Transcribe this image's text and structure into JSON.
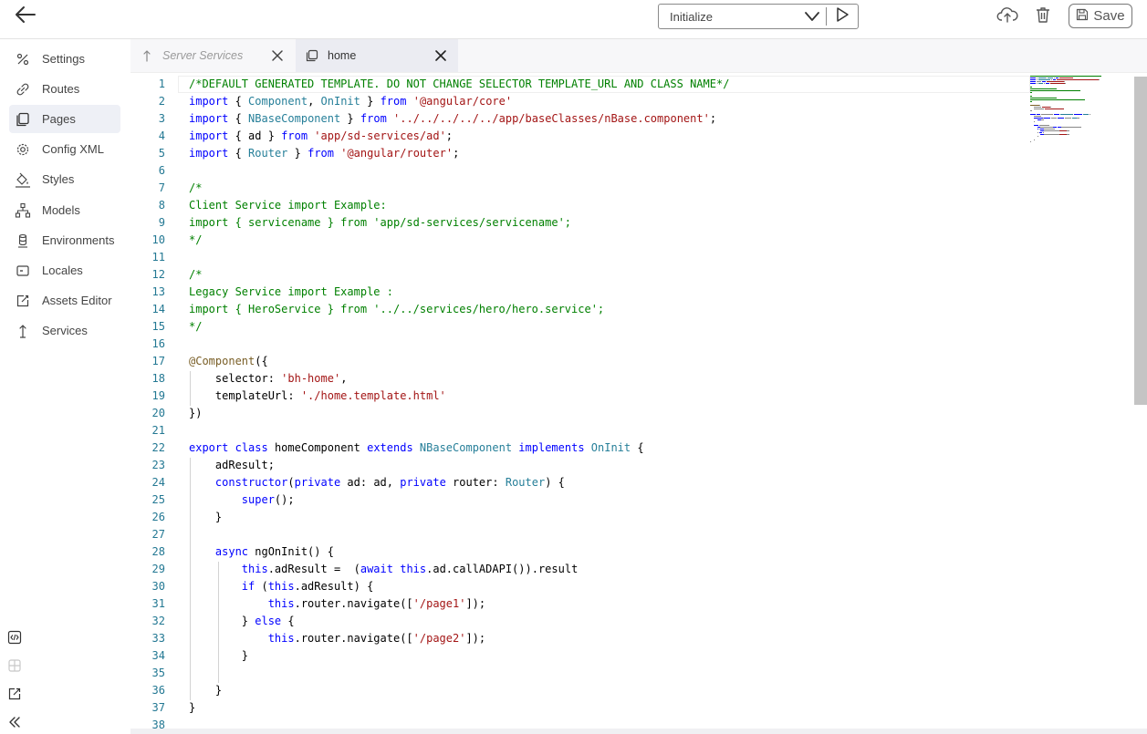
{
  "topbar": {
    "action_select": "Initialize",
    "save_label": "Save",
    "icons": [
      "back-arrow-icon",
      "chevron-down-icon",
      "play-icon",
      "cloud-upload-icon",
      "trash-icon",
      "save-disk-icon"
    ]
  },
  "sidebar": {
    "items": [
      {
        "label": "Settings",
        "icon": "settings-icon"
      },
      {
        "label": "Routes",
        "icon": "routes-icon"
      },
      {
        "label": "Pages",
        "icon": "pages-icon",
        "active": true
      },
      {
        "label": "Config XML",
        "icon": "config-gear-icon"
      },
      {
        "label": "Styles",
        "icon": "paint-bucket-icon"
      },
      {
        "label": "Models",
        "icon": "models-hierarchy-icon"
      },
      {
        "label": "Environments",
        "icon": "database-icon"
      },
      {
        "label": "Locales",
        "icon": "locales-icon"
      },
      {
        "label": "Assets Editor",
        "icon": "assets-editor-icon"
      },
      {
        "label": "Services",
        "icon": "services-icon"
      }
    ],
    "tools": [
      "code-icon",
      "grid-icon",
      "external-link-icon",
      "collapse-double-chevron-icon"
    ]
  },
  "tabs": [
    {
      "label": "Server Services",
      "icon": "services-icon",
      "active": false
    },
    {
      "label": "home",
      "icon": "file-copy-icon",
      "active": true
    }
  ],
  "editor": {
    "line_numbers": [
      "1",
      "2",
      "3",
      "4",
      "5",
      "6",
      "7",
      "8",
      "9",
      "10",
      "11",
      "12",
      "13",
      "14",
      "15",
      "16",
      "17",
      "18",
      "19",
      "20",
      "21",
      "22",
      "23",
      "24",
      "25",
      "26",
      "27",
      "28",
      "29",
      "30",
      "31",
      "32",
      "33",
      "34",
      "35",
      "36",
      "37",
      "38"
    ],
    "lines": [
      [
        [
          "c",
          "/*DEFAULT GENERATED TEMPLATE. DO NOT CHANGE SELECTOR TEMPLATE_URL AND CLASS NAME*/"
        ]
      ],
      [
        [
          "k",
          "import"
        ],
        [
          "p",
          " { "
        ],
        [
          "t",
          "Component"
        ],
        [
          "p",
          ", "
        ],
        [
          "t",
          "OnInit"
        ],
        [
          "p",
          " } "
        ],
        [
          "k",
          "from"
        ],
        [
          "p",
          " "
        ],
        [
          "s",
          "'@angular/core'"
        ]
      ],
      [
        [
          "k",
          "import"
        ],
        [
          "p",
          " { "
        ],
        [
          "t",
          "NBaseComponent"
        ],
        [
          "p",
          " } "
        ],
        [
          "k",
          "from"
        ],
        [
          "p",
          " "
        ],
        [
          "s",
          "'../../../../../app/baseClasses/nBase.component'"
        ],
        [
          "p",
          ";"
        ]
      ],
      [
        [
          "k",
          "import"
        ],
        [
          "p",
          " { ad } "
        ],
        [
          "k",
          "from"
        ],
        [
          "p",
          " "
        ],
        [
          "s",
          "'app/sd-services/ad'"
        ],
        [
          "p",
          ";"
        ]
      ],
      [
        [
          "k",
          "import"
        ],
        [
          "p",
          " { "
        ],
        [
          "t",
          "Router"
        ],
        [
          "p",
          " } "
        ],
        [
          "k",
          "from"
        ],
        [
          "p",
          " "
        ],
        [
          "s",
          "'@angular/router'"
        ],
        [
          "p",
          ";"
        ]
      ],
      [],
      [
        [
          "c",
          "/*"
        ]
      ],
      [
        [
          "c",
          "Client Service import Example:"
        ]
      ],
      [
        [
          "c",
          "import { servicename } from 'app/sd-services/servicename';"
        ]
      ],
      [
        [
          "c",
          "*/"
        ]
      ],
      [],
      [
        [
          "c",
          "/*"
        ]
      ],
      [
        [
          "c",
          "Legacy Service import Example :"
        ]
      ],
      [
        [
          "c",
          "import { HeroService } from '../../services/hero/hero.service';"
        ]
      ],
      [
        [
          "c",
          "*/"
        ]
      ],
      [],
      [
        [
          "d",
          "@Component"
        ],
        [
          "p",
          "({"
        ]
      ],
      [
        [
          "p",
          "    selector: "
        ],
        [
          "s",
          "'bh-home'"
        ],
        [
          "p",
          ","
        ]
      ],
      [
        [
          "p",
          "    templateUrl: "
        ],
        [
          "s",
          "'./home.template.html'"
        ]
      ],
      [
        [
          "p",
          "})"
        ]
      ],
      [],
      [
        [
          "k",
          "export"
        ],
        [
          "p",
          " "
        ],
        [
          "k",
          "class"
        ],
        [
          "p",
          " homeComponent "
        ],
        [
          "k",
          "extends"
        ],
        [
          "p",
          " "
        ],
        [
          "t",
          "NBaseComponent"
        ],
        [
          "p",
          " "
        ],
        [
          "k",
          "implements"
        ],
        [
          "p",
          " "
        ],
        [
          "t",
          "OnInit"
        ],
        [
          "p",
          " {"
        ]
      ],
      [
        [
          "p",
          "    adResult;"
        ]
      ],
      [
        [
          "p",
          "    "
        ],
        [
          "k",
          "constructor"
        ],
        [
          "p",
          "("
        ],
        [
          "k",
          "private"
        ],
        [
          "p",
          " ad: ad, "
        ],
        [
          "k",
          "private"
        ],
        [
          "p",
          " router: "
        ],
        [
          "t",
          "Router"
        ],
        [
          "p",
          ") {"
        ]
      ],
      [
        [
          "p",
          "        "
        ],
        [
          "k",
          "super"
        ],
        [
          "p",
          "();"
        ]
      ],
      [
        [
          "p",
          "    }"
        ]
      ],
      [],
      [
        [
          "p",
          "    "
        ],
        [
          "k",
          "async"
        ],
        [
          "p",
          " ngOnInit() {"
        ]
      ],
      [
        [
          "p",
          "        "
        ],
        [
          "k",
          "this"
        ],
        [
          "p",
          ".adResult =  ("
        ],
        [
          "k",
          "await"
        ],
        [
          "p",
          " "
        ],
        [
          "k",
          "this"
        ],
        [
          "p",
          ".ad.callADAPI()).result"
        ]
      ],
      [
        [
          "p",
          "        "
        ],
        [
          "k",
          "if"
        ],
        [
          "p",
          " ("
        ],
        [
          "k",
          "this"
        ],
        [
          "p",
          ".adResult) {"
        ]
      ],
      [
        [
          "p",
          "            "
        ],
        [
          "k",
          "this"
        ],
        [
          "p",
          ".router.navigate(["
        ],
        [
          "s",
          "'/page1'"
        ],
        [
          "p",
          "]);"
        ]
      ],
      [
        [
          "p",
          "        } "
        ],
        [
          "k",
          "else"
        ],
        [
          "p",
          " {"
        ]
      ],
      [
        [
          "p",
          "            "
        ],
        [
          "k",
          "this"
        ],
        [
          "p",
          ".router.navigate(["
        ],
        [
          "s",
          "'/page2'"
        ],
        [
          "p",
          "]);"
        ]
      ],
      [
        [
          "p",
          "        }"
        ]
      ],
      [],
      [
        [
          "p",
          "    }"
        ]
      ],
      [
        [
          "p",
          "}"
        ]
      ],
      []
    ],
    "colors": {
      "comment": "#008000",
      "keyword": "#0000ff",
      "string": "#a31515",
      "type": "#267f99",
      "decorator": "#795e26",
      "line_number": "#237893"
    }
  }
}
